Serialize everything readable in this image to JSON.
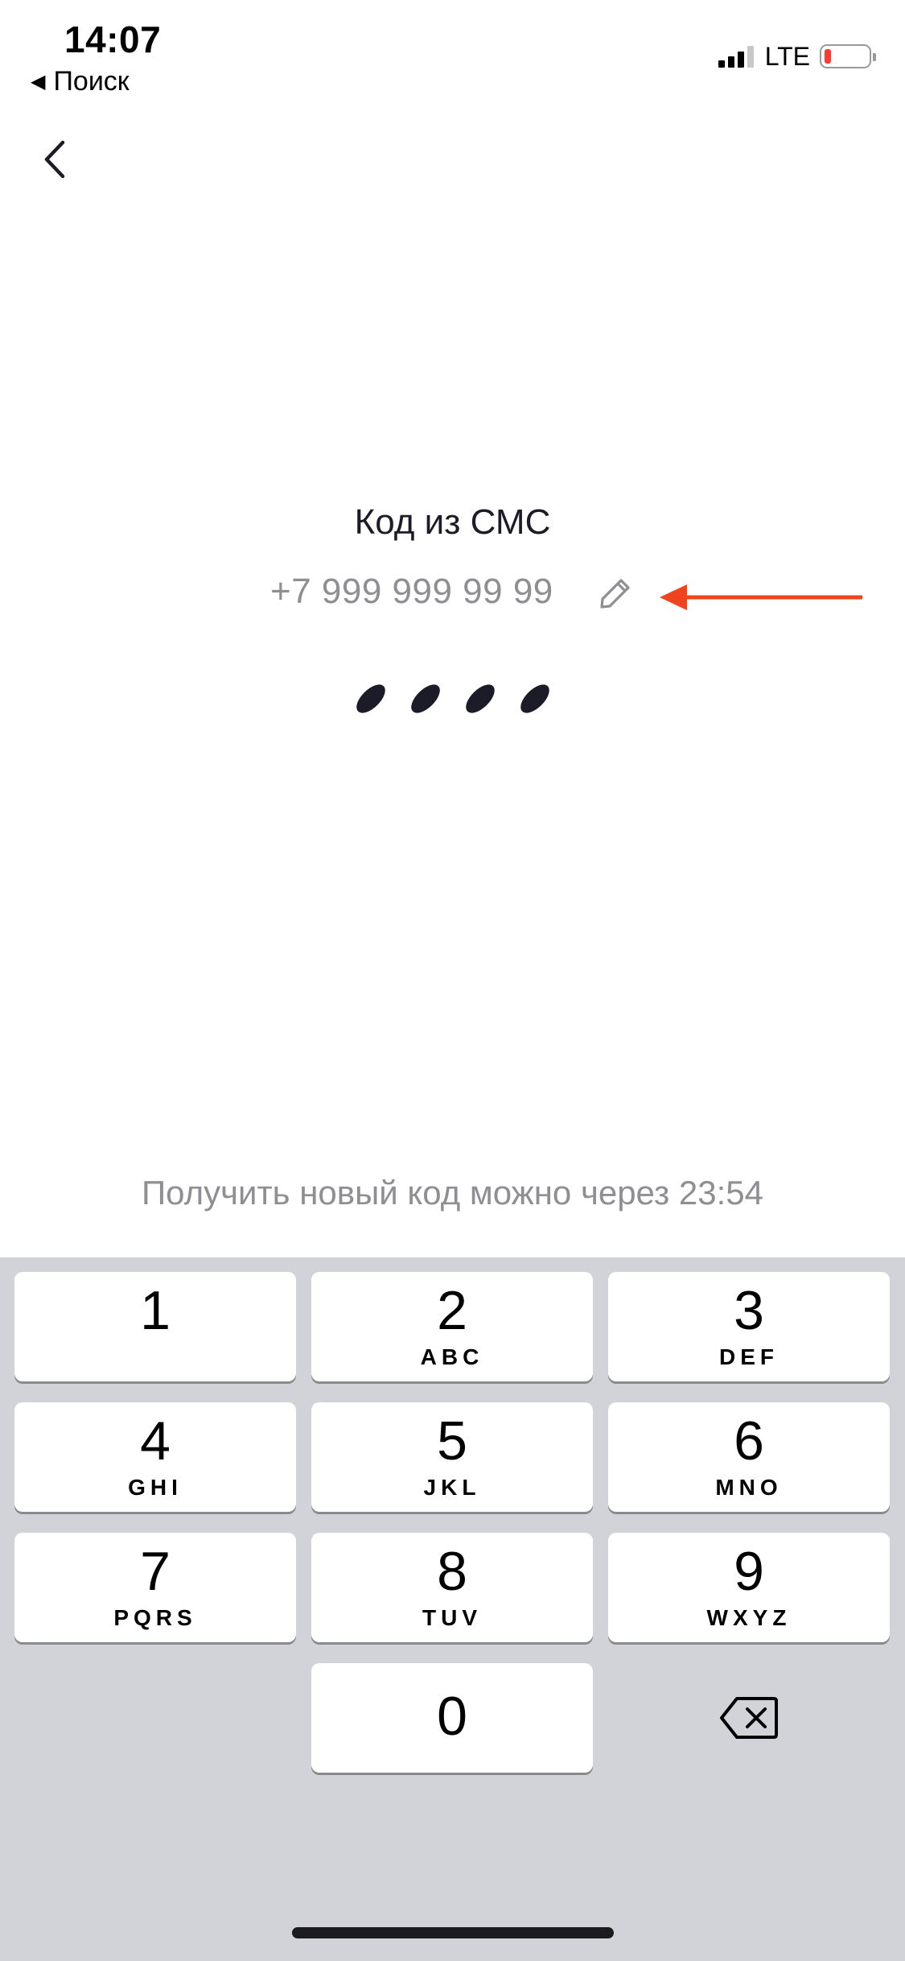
{
  "status_bar": {
    "time": "14:07",
    "back_app_label": "Поиск",
    "back_arrow_glyph": "◀",
    "network": "LTE",
    "battery_level": 0.15,
    "battery_color": "#ff3b30"
  },
  "nav": {
    "back_icon": "chevron-left-icon"
  },
  "verification": {
    "title": "Код из СМС",
    "phone": "+7 999 999 99 99",
    "edit_icon": "pencil-icon",
    "code_length": 4,
    "entered_digits": 4,
    "resend_text": "Получить новый код можно через 23:54"
  },
  "annotation": {
    "arrow_color": "#f0441f"
  },
  "keyboard": {
    "keys": [
      {
        "num": "1",
        "letters": ""
      },
      {
        "num": "2",
        "letters": "ABC"
      },
      {
        "num": "3",
        "letters": "DEF"
      },
      {
        "num": "4",
        "letters": "GHI"
      },
      {
        "num": "5",
        "letters": "JKL"
      },
      {
        "num": "6",
        "letters": "MNO"
      },
      {
        "num": "7",
        "letters": "PQRS"
      },
      {
        "num": "8",
        "letters": "TUV"
      },
      {
        "num": "9",
        "letters": "WXYZ"
      },
      {
        "num": "0",
        "letters": ""
      }
    ],
    "delete_icon": "backspace-icon"
  }
}
